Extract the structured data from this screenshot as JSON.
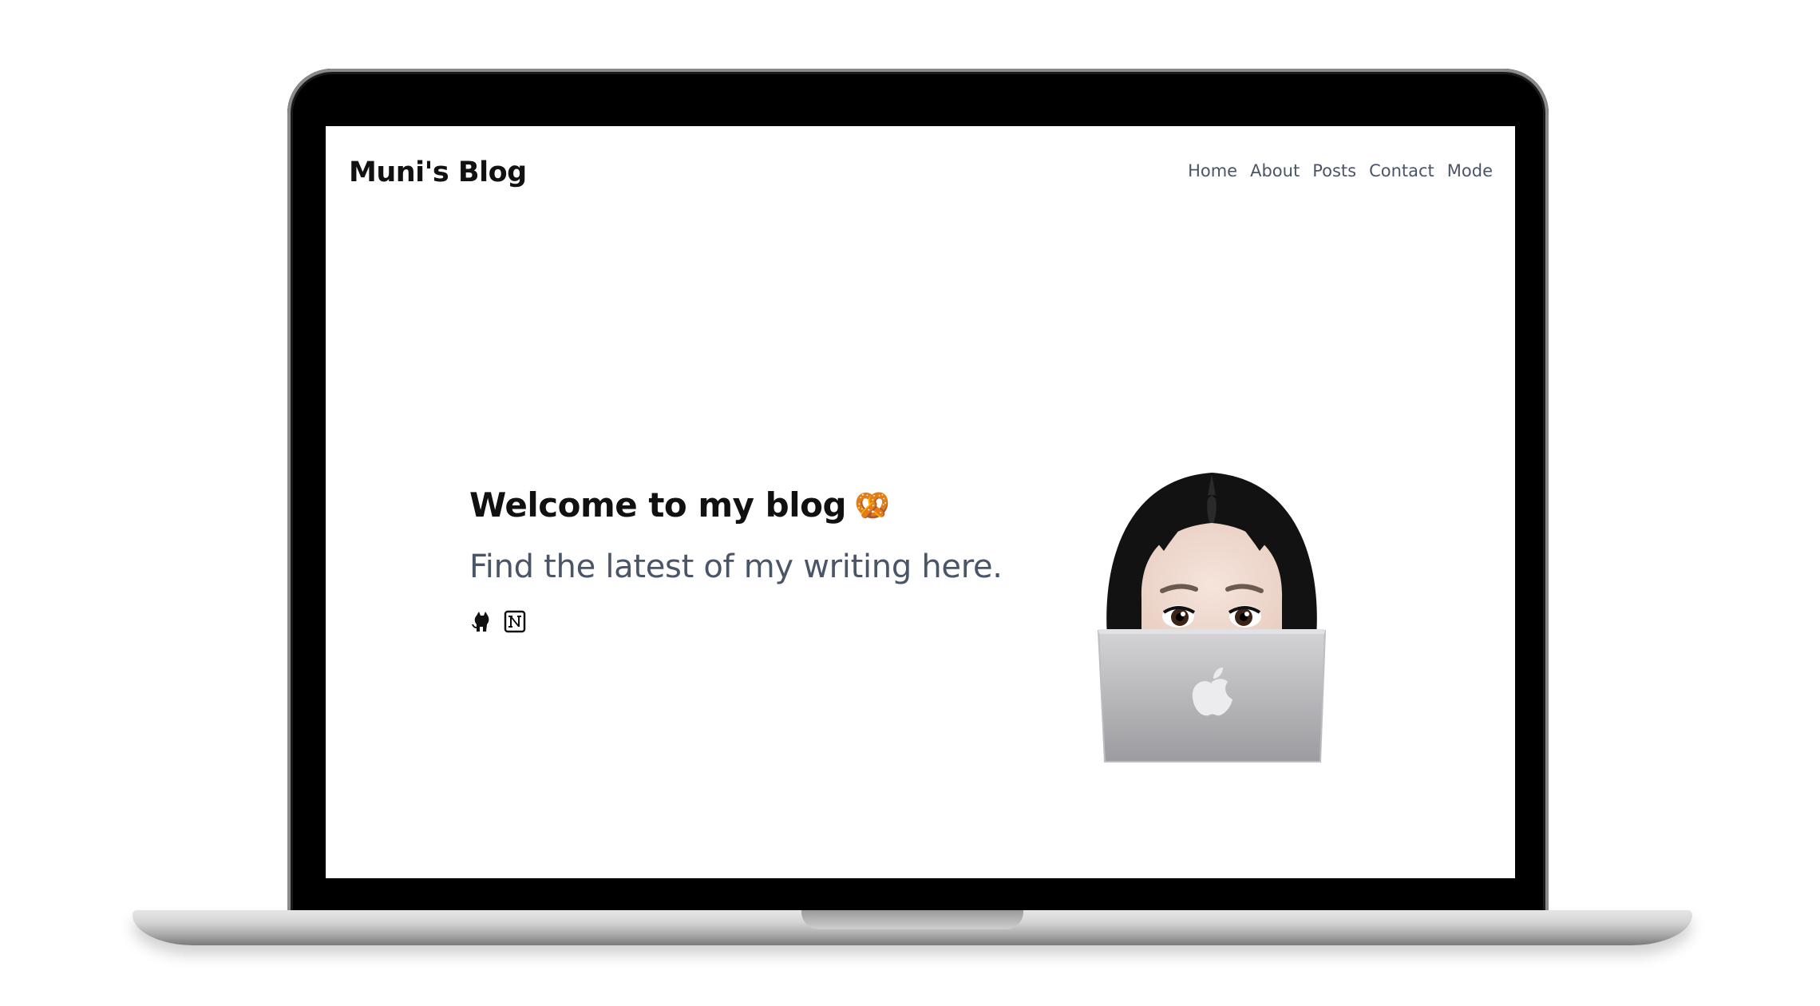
{
  "header": {
    "brand": "Muni's Blog",
    "nav": [
      {
        "label": "Home"
      },
      {
        "label": "About"
      },
      {
        "label": "Posts"
      },
      {
        "label": "Contact"
      },
      {
        "label": "Mode"
      }
    ]
  },
  "hero": {
    "title": "Welcome to my blog",
    "title_emoji": "🥨",
    "subtitle": "Find the latest of my writing here."
  },
  "socials": [
    {
      "icon": "github-icon"
    },
    {
      "icon": "notion-icon"
    }
  ],
  "avatar": {
    "icon": "memoji-laptop-avatar"
  },
  "colors": {
    "brand_text": "#111111",
    "nav_text": "#4a5568",
    "subtitle_text": "#4a5568",
    "screen_bg": "#ffffff"
  }
}
